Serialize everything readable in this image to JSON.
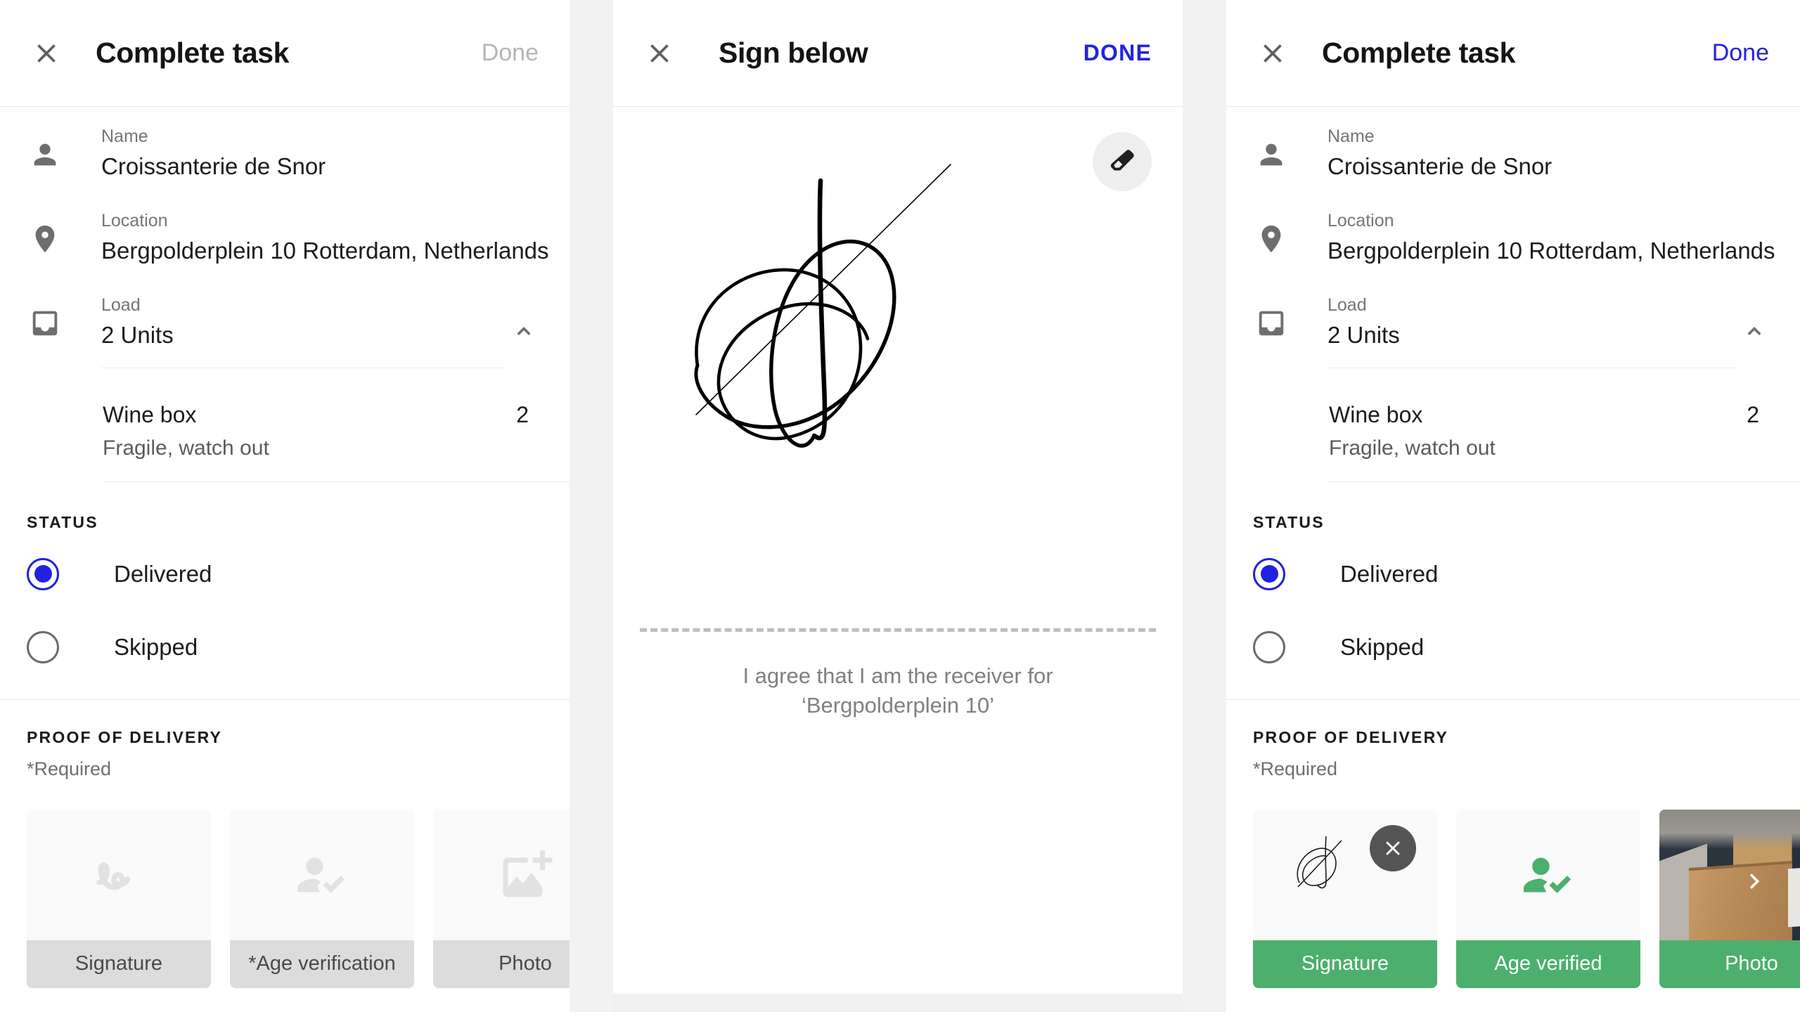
{
  "panels": {
    "left": {
      "header": {
        "title": "Complete task",
        "action": "Done",
        "close_icon": "close-icon"
      },
      "details": {
        "name": {
          "label": "Name",
          "value": "Croissanterie de Snor",
          "icon": "person-icon"
        },
        "location": {
          "label": "Location",
          "value": "Bergpolderplein 10 Rotterdam, Netherlands",
          "icon": "map-pin-icon"
        },
        "load": {
          "label": "Load",
          "value": "2 Units",
          "icon": "inbox-icon",
          "chevron": "chevron-up-icon"
        }
      },
      "items": [
        {
          "name": "Wine box",
          "qty": "2",
          "note": "Fragile, watch out"
        }
      ],
      "status": {
        "title": "STATUS",
        "options": [
          {
            "label": "Delivered",
            "selected": true
          },
          {
            "label": "Skipped",
            "selected": false
          }
        ]
      },
      "proof": {
        "title": "PROOF OF DELIVERY",
        "required_note": "*Required",
        "tiles": [
          {
            "label": "Signature",
            "icon": "signature-icon",
            "filled": false
          },
          {
            "label": "*Age verification",
            "icon": "age-verify-icon",
            "filled": false
          },
          {
            "label": "Photo",
            "icon": "add-photo-icon",
            "filled": false
          }
        ]
      }
    },
    "middle": {
      "header": {
        "title": "Sign below",
        "action": "DONE",
        "close_icon": "close-icon"
      },
      "erase_icon": "eraser-icon",
      "agreement": "I agree that I am the receiver for ‘Bergpolderplein 10’"
    },
    "right": {
      "header": {
        "title": "Complete task",
        "action": "Done",
        "close_icon": "close-icon"
      },
      "details": {
        "name": {
          "label": "Name",
          "value": "Croissanterie de Snor",
          "icon": "person-icon"
        },
        "location": {
          "label": "Location",
          "value": "Bergpolderplein 10 Rotterdam, Netherlands",
          "icon": "map-pin-icon"
        },
        "load": {
          "label": "Load",
          "value": "2 Units",
          "icon": "inbox-icon",
          "chevron": "chevron-up-icon"
        }
      },
      "items": [
        {
          "name": "Wine box",
          "qty": "2",
          "note": "Fragile, watch out"
        }
      ],
      "status": {
        "title": "STATUS",
        "options": [
          {
            "label": "Delivered",
            "selected": true
          },
          {
            "label": "Skipped",
            "selected": false
          }
        ]
      },
      "proof": {
        "title": "PROOF OF DELIVERY",
        "required_note": "*Required",
        "tiles": [
          {
            "label": "Signature",
            "icon": "signature-thumb-icon",
            "filled": true,
            "remove_icon": "remove-circle-icon"
          },
          {
            "label": "Age verified",
            "icon": "age-verified-icon",
            "filled": true
          },
          {
            "label": "Photo",
            "icon": "photo-thumbnail",
            "filled": true
          }
        ],
        "next_icon": "chevron-right-icon"
      }
    }
  },
  "colors": {
    "accent_blue": "#2121e0",
    "success_green": "#4caf6e",
    "disabled_grey": "#b6b6b6",
    "tile_grey": "#dcdcdc"
  }
}
